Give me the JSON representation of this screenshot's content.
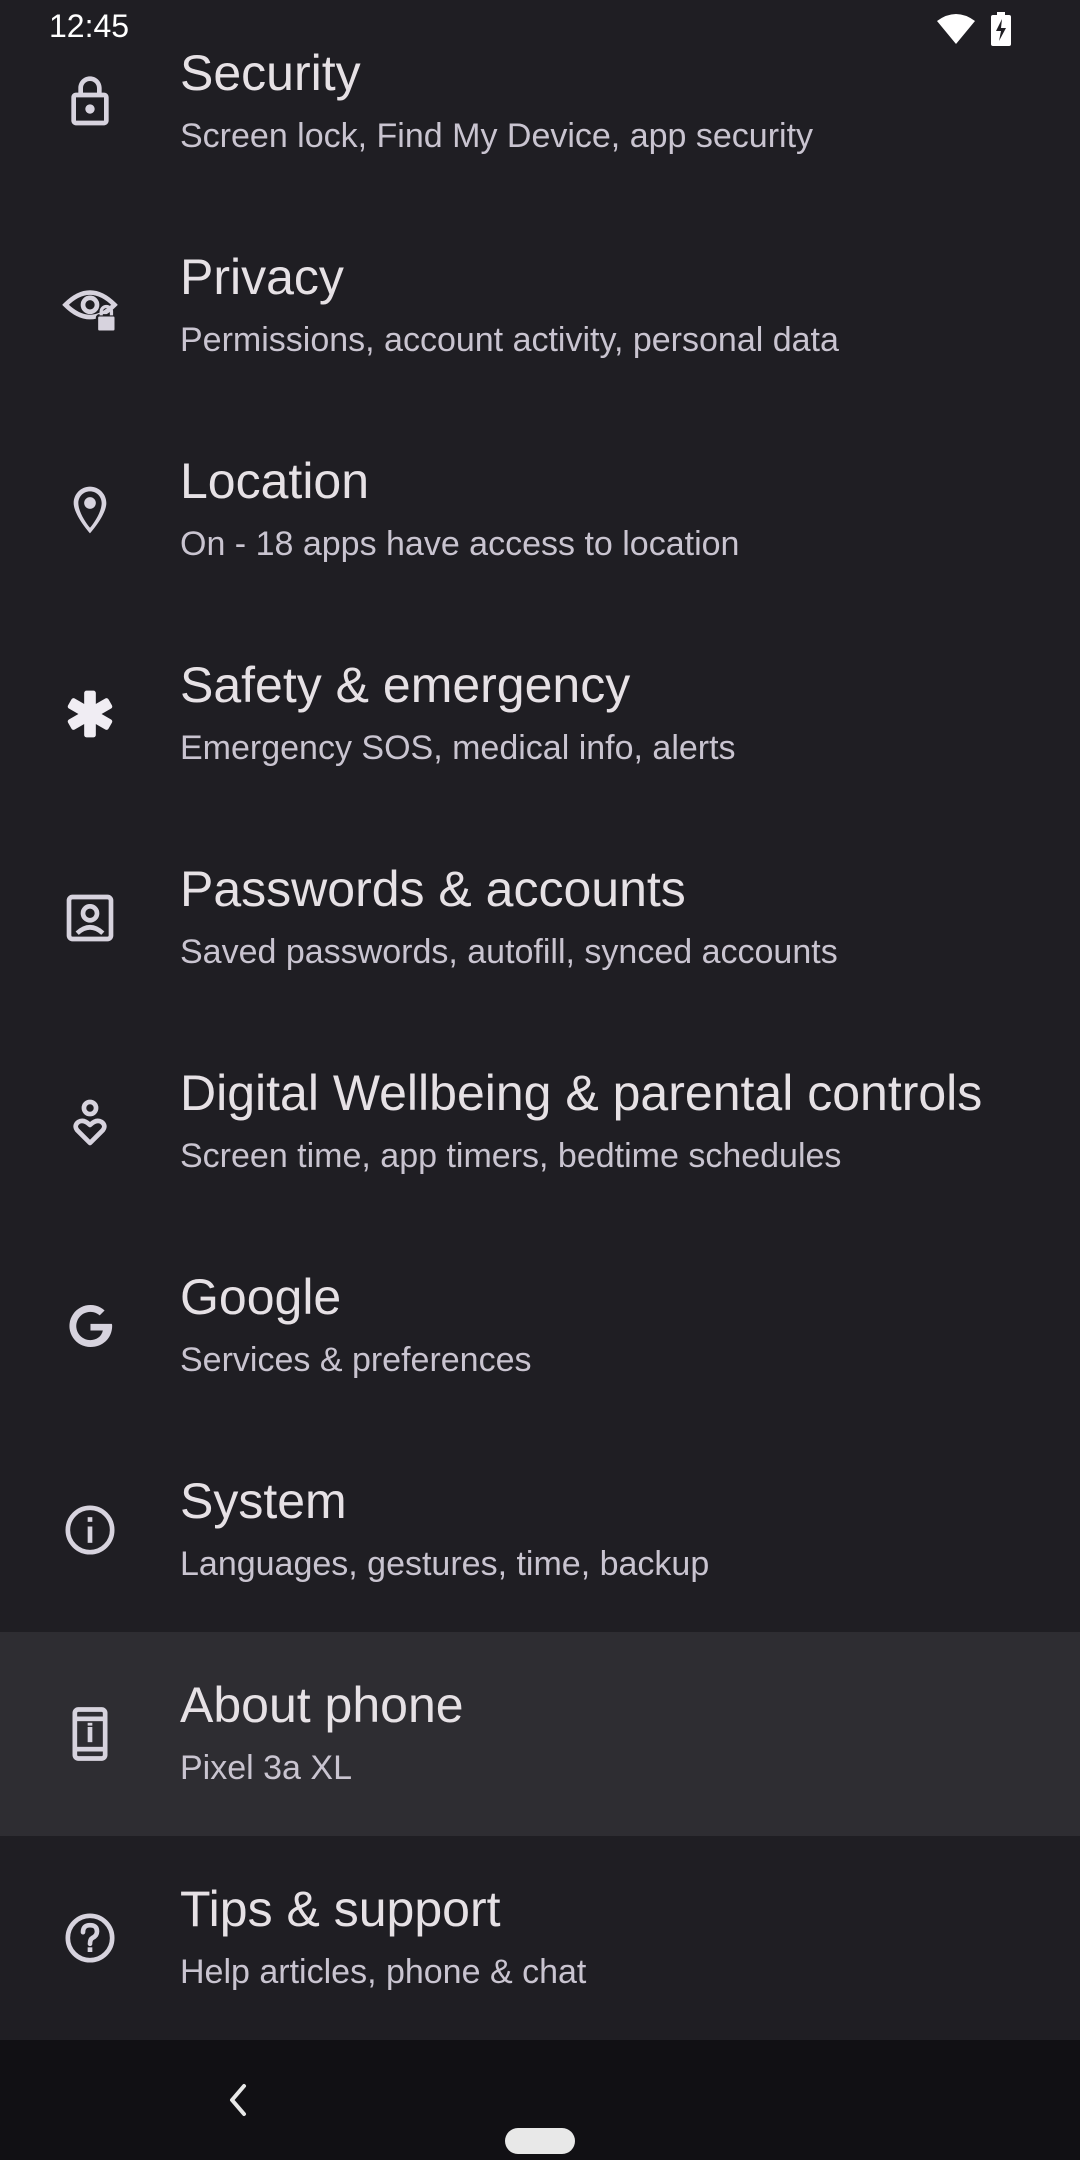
{
  "status_bar": {
    "time": "12:45",
    "icons": [
      "wifi-icon",
      "battery-charging-icon"
    ]
  },
  "settings": {
    "items": [
      {
        "title": "Security",
        "subtitle": "Screen lock, Find My Device, app security",
        "icon": "lock-icon"
      },
      {
        "title": "Privacy",
        "subtitle": "Permissions, account activity, personal data",
        "icon": "privacy-eye-icon"
      },
      {
        "title": "Location",
        "subtitle": "On - 18 apps have access to location",
        "icon": "location-pin-icon"
      },
      {
        "title": "Safety & emergency",
        "subtitle": "Emergency SOS, medical info, alerts",
        "icon": "asterisk-icon"
      },
      {
        "title": "Passwords & accounts",
        "subtitle": "Saved passwords, autofill, synced accounts",
        "icon": "account-box-icon"
      },
      {
        "title": "Digital Wellbeing & parental controls",
        "subtitle": "Screen time, app timers, bedtime schedules",
        "icon": "wellbeing-icon"
      },
      {
        "title": "Google",
        "subtitle": "Services & preferences",
        "icon": "google-g-icon"
      },
      {
        "title": "System",
        "subtitle": "Languages, gestures, time, backup",
        "icon": "info-icon"
      },
      {
        "title": "About phone",
        "subtitle": "Pixel 3a XL",
        "icon": "phone-icon",
        "highlighted": true
      },
      {
        "title": "Tips & support",
        "subtitle": "Help articles, phone & chat",
        "icon": "help-icon"
      }
    ]
  },
  "nav_bar": {
    "buttons": [
      "back-button",
      "home-handle"
    ]
  },
  "colors": {
    "background": "#1f1e23",
    "highlight": "#2e2d32",
    "title_text": "#e6e1e5",
    "subtitle_text": "#c9c4d0",
    "icon": "#d7d3de",
    "nav_bar": "#111014"
  }
}
